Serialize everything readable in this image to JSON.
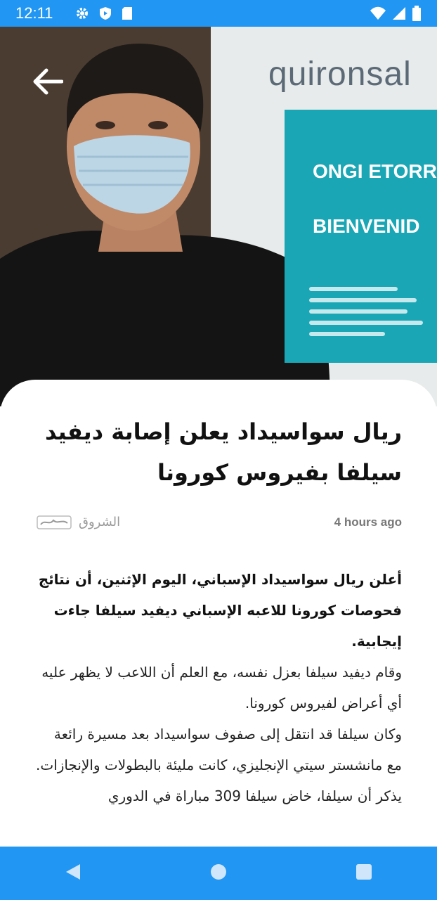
{
  "status_bar": {
    "time": "12:11",
    "icons": [
      "gear-icon",
      "shield-icon",
      "sd-card-icon",
      "wifi-icon",
      "signal-icon",
      "battery-icon"
    ]
  },
  "hero": {
    "sign_brand": "quironsal",
    "sign_line1": "ONGI ETORR",
    "sign_line2": "BIENVENID"
  },
  "article": {
    "title": "ريال سواسيداد يعلن إصابة ديفيد سيلفا بفيروس كورونا",
    "time_ago": "4 hours ago",
    "source_name": "الشروق",
    "source_logo_text": "الشروق",
    "paragraphs": {
      "lead": "أعلن ريال سواسيداد الإسباني، اليوم الإثنين، أن نتائج فحوصات كورونا للاعبه الإسباني ديفيد سيلفا جاءت إيجابية.",
      "p2": "وقام ديفيد سيلفا بعزل نفسه، مع العلم أن اللاعب لا يظهر عليه أي أعراض لفيروس كورونا.",
      "p3": "وكان سيلفا قد انتقل إلى صفوف سواسيداد بعد مسيرة رائعة مع مانشستر سيتي الإنجليزي، كانت مليئة بالبطولات والإنجازات.",
      "p4": "يذكر أن سيلفا، خاض سيلفا 309 مباراة في الدوري"
    }
  },
  "colors": {
    "accent": "#2196f3",
    "sign_teal": "#1aa6b5"
  },
  "nav_bar": {
    "icons": [
      "back-triangle-icon",
      "home-circle-icon",
      "recents-square-icon"
    ]
  }
}
